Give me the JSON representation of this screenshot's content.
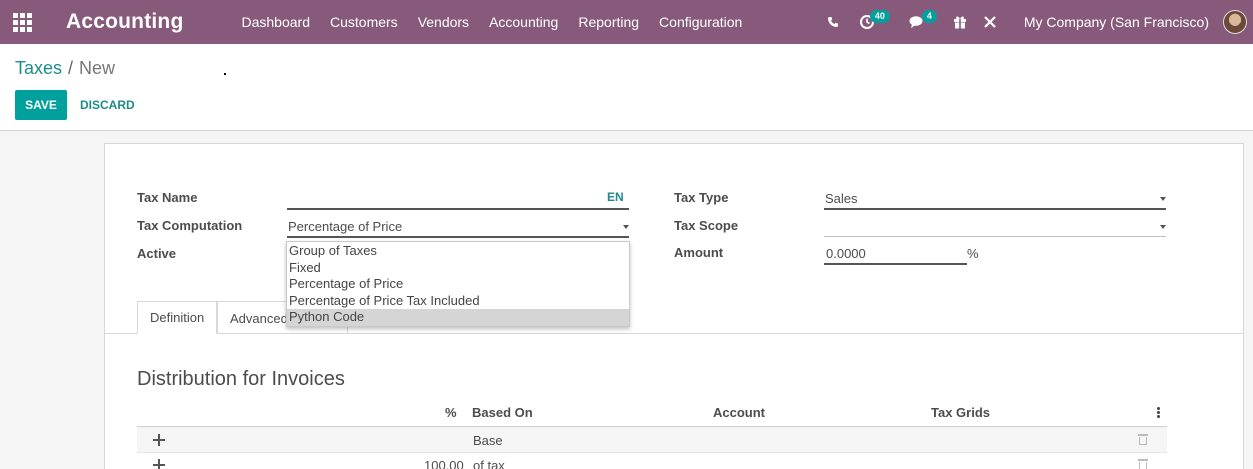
{
  "navbar": {
    "app_title": "Accounting",
    "menu": [
      "Dashboard",
      "Customers",
      "Vendors",
      "Accounting",
      "Reporting",
      "Configuration"
    ],
    "activity_badge": "40",
    "messages_badge": "4",
    "company": "My Company (San Francisco)"
  },
  "breadcrumb": {
    "parent": "Taxes",
    "separator": "/",
    "current": "New"
  },
  "buttons": {
    "save": "SAVE",
    "discard": "DISCARD"
  },
  "form": {
    "tax_name_label": "Tax Name",
    "tax_name_value": "",
    "lang_tag": "EN",
    "tax_computation_label": "Tax Computation",
    "tax_computation_value": "Percentage of Price",
    "active_label": "Active",
    "tax_type_label": "Tax Type",
    "tax_type_value": "Sales",
    "tax_scope_label": "Tax Scope",
    "tax_scope_value": "",
    "amount_label": "Amount",
    "amount_value": "0.0000",
    "amount_unit": "%"
  },
  "dropdown": {
    "options": [
      "Group of Taxes",
      "Fixed",
      "Percentage of Price",
      "Percentage of Price Tax Included",
      "Python Code"
    ],
    "highlighted": "Python Code"
  },
  "tabs": {
    "definition": "Definition",
    "advanced": "Advanced"
  },
  "distribution": {
    "title": "Distribution for Invoices",
    "columns": {
      "percent": "%",
      "based_on": "Based On",
      "account": "Account",
      "tax_grids": "Tax Grids"
    },
    "rows": [
      {
        "percent": "",
        "based_on": "Base"
      },
      {
        "percent": "100.00",
        "based_on": "of tax"
      }
    ]
  },
  "icons": {
    "apps": "apps-grid-icon",
    "phone": "phone-icon",
    "activity": "clock-icon",
    "messages": "chat-icon",
    "gift": "gift-icon",
    "debug": "tools-icon",
    "drag": "move-icon",
    "delete": "trash-icon",
    "options": "kebab-icon"
  },
  "colors": {
    "navbar": "#875a7b",
    "primary": "#00a09d",
    "link": "#1f8b8b"
  }
}
